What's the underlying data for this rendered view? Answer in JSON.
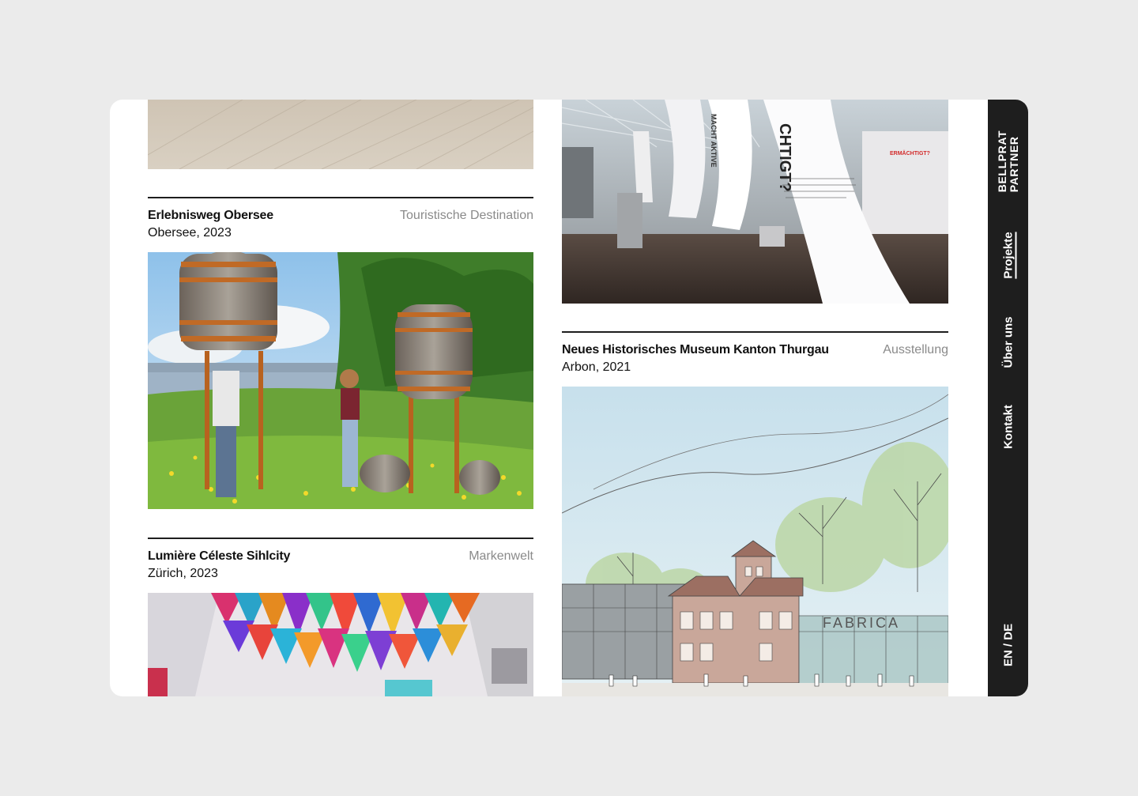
{
  "brand": {
    "line1": "BELLPRAT",
    "line2": "PARTNER"
  },
  "nav": {
    "items": [
      {
        "label": "Projekte",
        "active": true
      },
      {
        "label": "Über uns",
        "active": false
      },
      {
        "label": "Kontakt",
        "active": false
      }
    ],
    "language": "EN / DE"
  },
  "projects": [
    {
      "title": "Erlebnisweg Obersee",
      "location_year": "Obersee, 2023",
      "category": "Touristische Destination"
    },
    {
      "title": "Lumière Céleste Sihlcity",
      "location_year": "Zürich, 2023",
      "category": "Markenwelt"
    },
    {
      "title": "Neues Historisches Museum Kanton Thurgau",
      "location_year": "Arbon, 2021",
      "category": "Ausstellung"
    }
  ],
  "image_labels": {
    "exhibit_banner_big": "CHTIGT?",
    "exhibit_banner_small": "MACHT AKTIVE",
    "exhibit_wall": "ERMÄCHTIGT?",
    "sketch_sign": "FABRICA"
  }
}
